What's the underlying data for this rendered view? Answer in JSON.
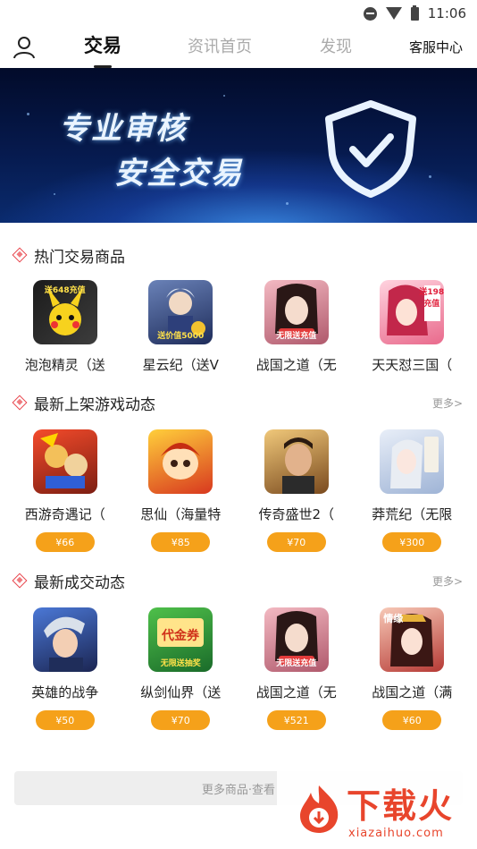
{
  "status_bar": {
    "time": "11:06"
  },
  "nav": {
    "tabs": [
      {
        "label": "交易",
        "active": true
      },
      {
        "label": "资讯首页",
        "active": false
      },
      {
        "label": "发现",
        "active": false
      }
    ],
    "service_label": "客服中心"
  },
  "banner": {
    "line1": "专业审核",
    "line2": "安全交易"
  },
  "sections": {
    "hot": {
      "title": "热门交易商品",
      "items": [
        {
          "name": "泡泡精灵（送",
          "tag": "送648充值"
        },
        {
          "name": "星云纪（送V",
          "tag": "送价值5000"
        },
        {
          "name": "战国之道（无",
          "tag": "无限送充值"
        },
        {
          "name": "天天怼三国（",
          "tag": "送198充值"
        }
      ]
    },
    "new_games": {
      "title": "最新上架游戏动态",
      "more": "更多>",
      "items": [
        {
          "name": "西游奇遇记（",
          "price": "¥66"
        },
        {
          "name": "思仙（海量特",
          "price": "¥85"
        },
        {
          "name": "传奇盛世2（",
          "price": "¥70"
        },
        {
          "name": "莽荒纪（无限",
          "price": "¥300"
        }
      ]
    },
    "new_deals": {
      "title": "最新成交动态",
      "more": "更多>",
      "items": [
        {
          "name": "英雄的战争",
          "price": "¥50"
        },
        {
          "name": "纵剑仙界（送",
          "price": "¥70",
          "tag": "无限送抽奖"
        },
        {
          "name": "战国之道（无",
          "price": "¥521",
          "tag": "无限送充值"
        },
        {
          "name": "战国之道（满",
          "price": "¥60",
          "tag": "情缘"
        }
      ]
    }
  },
  "more_bar": "更多商品·查看",
  "watermark": {
    "text": "下载火",
    "sub": "xiazaihuo.com"
  },
  "colors": {
    "price_badge": "#f5a11a",
    "section_icon": "#e8424a",
    "watermark": "#e8452c"
  }
}
